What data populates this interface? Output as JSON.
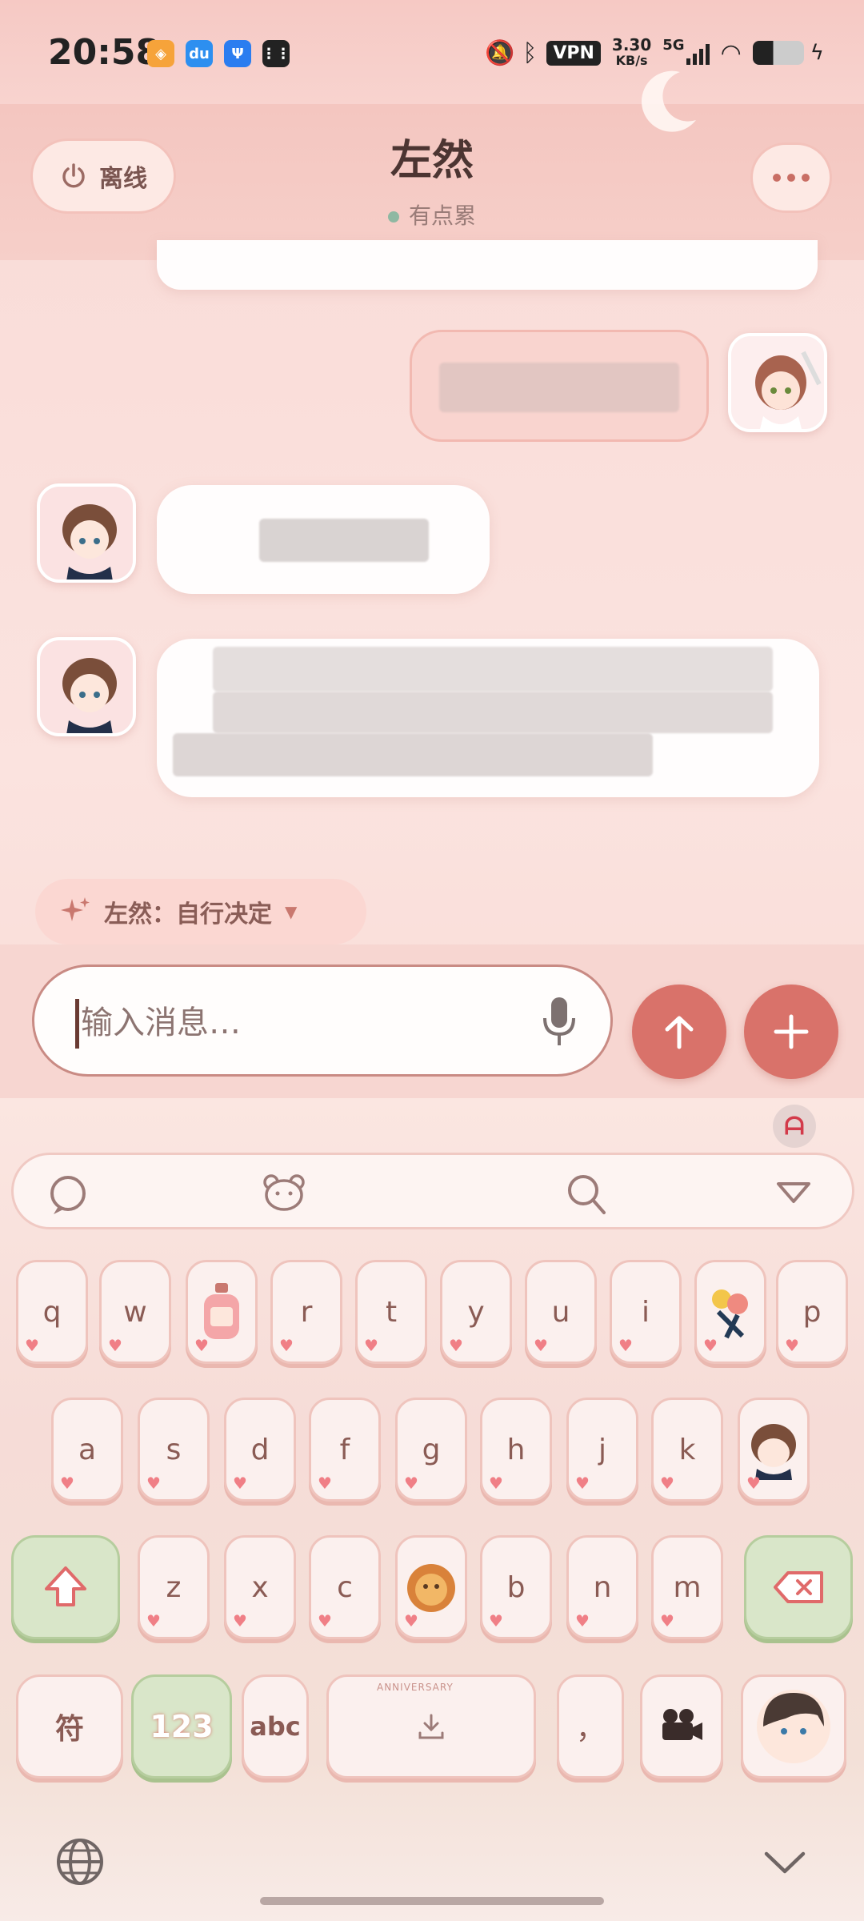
{
  "status_bar": {
    "time": "20:58",
    "vpn": "VPN",
    "speed_value": "3.30",
    "speed_unit": "KB/s",
    "network": "5G"
  },
  "header": {
    "offline_label": "离线",
    "title": "左然",
    "status_text": "有点累"
  },
  "decision_chip": {
    "label": "左然：自行决定"
  },
  "composer": {
    "placeholder": "输入消息…"
  },
  "keyboard": {
    "row1": [
      "q",
      "w",
      "",
      "r",
      "t",
      "y",
      "u",
      "i",
      "",
      "p"
    ],
    "row2": [
      "a",
      "s",
      "d",
      "f",
      "g",
      "h",
      "j",
      "k",
      ""
    ],
    "row3": [
      "z",
      "x",
      "c",
      "",
      "b",
      "n",
      "m"
    ],
    "symbol_key": "符",
    "num_key": "123",
    "abc_key": "abc",
    "space_badge": "ANNIVERSARY",
    "punct_key": "，"
  },
  "colors": {
    "accent": "#d9726a",
    "header_bg": "#f4c6c0",
    "status_dot": "#8fb8a2"
  }
}
